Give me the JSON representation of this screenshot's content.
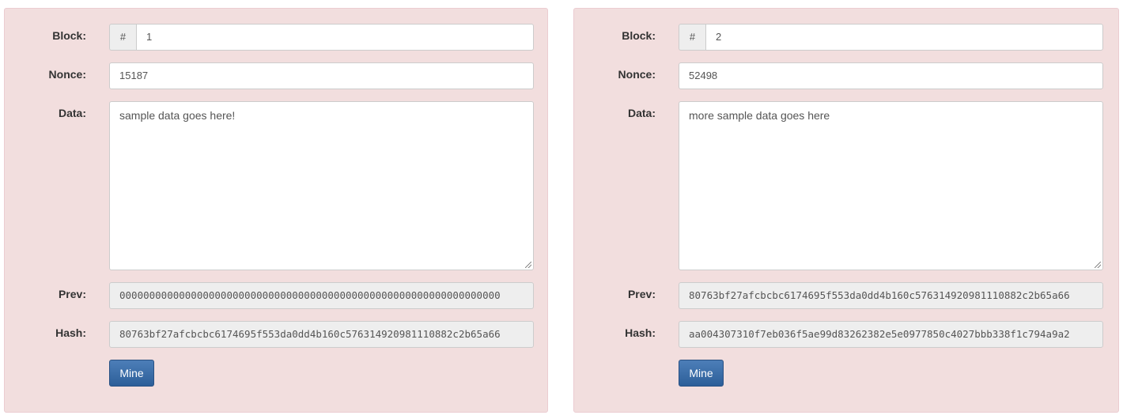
{
  "labels": {
    "block": "Block:",
    "nonce": "Nonce:",
    "data": "Data:",
    "prev": "Prev:",
    "hash": "Hash:",
    "hash_addon": "#",
    "mine": "Mine"
  },
  "blocks": [
    {
      "number": "1",
      "nonce": "15187",
      "data": "sample data goes here!",
      "prev": "0000000000000000000000000000000000000000000000000000000000000000",
      "hash": "80763bf27afcbcbc6174695f553da0dd4b160c576314920981110882c2b65a66"
    },
    {
      "number": "2",
      "nonce": "52498",
      "data": "more sample data goes here",
      "prev": "80763bf27afcbcbc6174695f553da0dd4b160c576314920981110882c2b65a66",
      "hash": "aa004307310f7eb036f5ae99d83262382e5e0977850c4027bbb338f1c794a9a2"
    }
  ],
  "colors": {
    "panel_bg": "#f2dede",
    "button_bg": "#2d5f99"
  }
}
